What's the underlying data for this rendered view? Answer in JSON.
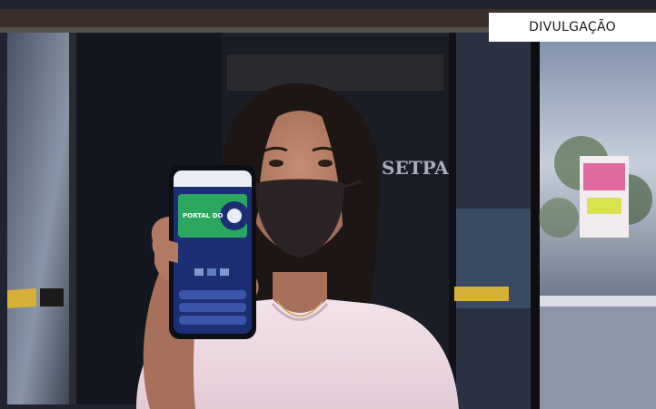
{
  "photo": {
    "storefront_sign": "SETPA",
    "phone_screen_title": "PORTAL DO"
  },
  "credit": {
    "label": "DIVULGAÇÃO"
  },
  "colors": {
    "phone_screen_bg": "#1d2f74",
    "phone_banner_green": "#2aa860",
    "blouse": "#f0dde4",
    "mask": "#2b2326",
    "hair": "#1e1615"
  }
}
